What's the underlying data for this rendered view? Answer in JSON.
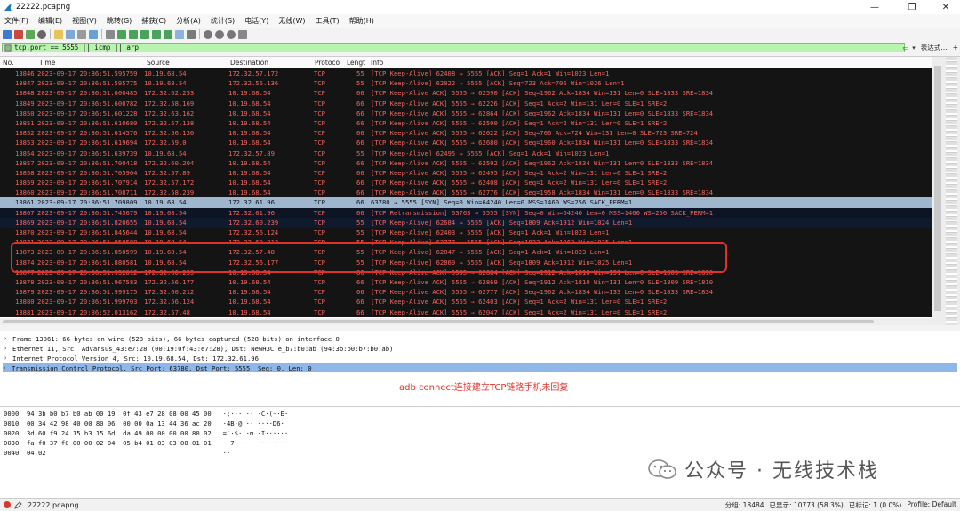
{
  "window": {
    "title": "22222.pcapng",
    "controls": [
      "—",
      "❐",
      "✕"
    ]
  },
  "menu": [
    "文件(F)",
    "编辑(E)",
    "视图(V)",
    "跳转(G)",
    "捕获(C)",
    "分析(A)",
    "统计(S)",
    "电话(Y)",
    "无线(W)",
    "工具(T)",
    "帮助(H)"
  ],
  "filter": {
    "text": "tcp.port == 5555 || icmp || arp",
    "expression_label": "表达式…",
    "plus": "+"
  },
  "columns": {
    "no": "No.",
    "time": "Time",
    "source": "Source",
    "destination": "Destination",
    "protocol": "Protoco",
    "length": "Lengt",
    "info": "Info"
  },
  "packets": [
    {
      "no": "13846",
      "time": "2023-09-17 20:36:51.595759",
      "src": "10.19.68.54",
      "dst": "172.32.57.172",
      "proto": "TCP",
      "len": "55",
      "info": "[TCP Keep-Alive] 62408 → 5555 [ACK] Seq=1 Ack=1 Win=1023 Len=1"
    },
    {
      "no": "13847",
      "time": "2023-09-17 20:36:51.595775",
      "src": "10.19.68.54",
      "dst": "172.32.56.136",
      "proto": "TCP",
      "len": "55",
      "info": "[TCP Keep-Alive] 62022 → 5555 [ACK] Seq=723 Ack=706 Win=1026 Len=1"
    },
    {
      "no": "13848",
      "time": "2023-09-17 20:36:51.600485",
      "src": "172.32.62.253",
      "dst": "10.19.68.54",
      "proto": "TCP",
      "len": "66",
      "info": "[TCP Keep-Alive ACK] 5555 → 62590 [ACK] Seq=1962 Ack=1834 Win=131 Len=0 SLE=1833 SRE=1834"
    },
    {
      "no": "13849",
      "time": "2023-09-17 20:36:51.600782",
      "src": "172.32.58.169",
      "dst": "10.19.68.54",
      "proto": "TCP",
      "len": "66",
      "info": "[TCP Keep-Alive ACK] 5555 → 62226 [ACK] Seq=1 Ack=2 Win=131 Len=0 SLE=1 SRE=2"
    },
    {
      "no": "13850",
      "time": "2023-09-17 20:36:51.601228",
      "src": "172.32.63.162",
      "dst": "10.19.68.54",
      "proto": "TCP",
      "len": "66",
      "info": "[TCP Keep-Alive ACK] 5555 → 62864 [ACK] Seq=1962 Ack=1834 Win=131 Len=0 SLE=1833 SRE=1834"
    },
    {
      "no": "13851",
      "time": "2023-09-17 20:36:51.610680",
      "src": "172.32.57.138",
      "dst": "10.19.68.54",
      "proto": "TCP",
      "len": "66",
      "info": "[TCP Keep-Alive ACK] 5555 → 62500 [ACK] Seq=1 Ack=2 Win=131 Len=0 SLE=1 SRE=2"
    },
    {
      "no": "13852",
      "time": "2023-09-17 20:36:51.614576",
      "src": "172.32.56.136",
      "dst": "10.19.68.54",
      "proto": "TCP",
      "len": "66",
      "info": "[TCP Keep-Alive ACK] 5555 → 62022 [ACK] Seq=706 Ack=724 Win=131 Len=0 SLE=723 SRE=724"
    },
    {
      "no": "13853",
      "time": "2023-09-17 20:36:51.619694",
      "src": "172.32.59.0",
      "dst": "10.19.68.54",
      "proto": "TCP",
      "len": "66",
      "info": "[TCP Keep-Alive ACK] 5555 → 62680 [ACK] Seq=1960 Ack=1834 Win=131 Len=0 SLE=1833 SRE=1834"
    },
    {
      "no": "13854",
      "time": "2023-09-17 20:36:51.639739",
      "src": "10.19.68.54",
      "dst": "172.32.57.89",
      "proto": "TCP",
      "len": "55",
      "info": "[TCP Keep-Alive] 62495 → 5555 [ACK] Seq=1 Ack=1 Win=1023 Len=1"
    },
    {
      "no": "13857",
      "time": "2023-09-17 20:36:51.700418",
      "src": "172.32.60.204",
      "dst": "10.19.68.54",
      "proto": "TCP",
      "len": "66",
      "info": "[TCP Keep-Alive ACK] 5555 → 62592 [ACK] Seq=1962 Ack=1834 Win=131 Len=0 SLE=1833 SRE=1834"
    },
    {
      "no": "13858",
      "time": "2023-09-17 20:36:51.705904",
      "src": "172.32.57.89",
      "dst": "10.19.68.54",
      "proto": "TCP",
      "len": "66",
      "info": "[TCP Keep-Alive ACK] 5555 → 62495 [ACK] Seq=1 Ack=2 Win=131 Len=0 SLE=1 SRE=2"
    },
    {
      "no": "13859",
      "time": "2023-09-17 20:36:51.707914",
      "src": "172.32.57.172",
      "dst": "10.19.68.54",
      "proto": "TCP",
      "len": "66",
      "info": "[TCP Keep-Alive ACK] 5555 → 62408 [ACK] Seq=1 Ack=2 Win=131 Len=0 SLE=1 SRE=2"
    },
    {
      "no": "13860",
      "time": "2023-09-17 20:36:51.708711",
      "src": "172.32.58.239",
      "dst": "10.19.68.54",
      "proto": "TCP",
      "len": "66",
      "info": "[TCP Keep-Alive ACK] 5555 → 62776 [ACK] Seq=1958 Ack=1834 Win=131 Len=0 SLE=1833 SRE=1834"
    },
    {
      "no": "13861",
      "time": "2023-09-17 20:36:51.709809",
      "src": "10.19.68.54",
      "dst": "172.32.61.96",
      "proto": "TCP",
      "len": "66",
      "info": "63780 → 5555 [SYN] Seq=0 Win=64240 Len=0 MSS=1460 WS=256 SACK_PERM=1"
    },
    {
      "no": "13867",
      "time": "2023-09-17 20:36:51.745679",
      "src": "10.19.68.54",
      "dst": "172.32.61.96",
      "proto": "TCP",
      "len": "66",
      "info": "[TCP Retransmission] 63763 → 5555 [SYN] Seq=0 Win=64240 Len=0 MSS=1460 WS=256 SACK_PERM=1"
    },
    {
      "no": "13869",
      "time": "2023-09-17 20:36:51.820655",
      "src": "10.19.68.54",
      "dst": "172.32.60.239",
      "proto": "TCP",
      "len": "55",
      "info": "[TCP Keep-Alive] 62684 → 5555 [ACK] Seq=1809 Ack=1912 Win=1024 Len=1"
    },
    {
      "no": "13870",
      "time": "2023-09-17 20:36:51.845644",
      "src": "10.19.68.54",
      "dst": "172.32.56.124",
      "proto": "TCP",
      "len": "55",
      "info": "[TCP Keep-Alive] 62403 → 5555 [ACK] Seq=1 Ack=1 Win=1023 Len=1"
    },
    {
      "no": "13871",
      "time": "2023-09-17 20:36:51.850588",
      "src": "10.19.68.54",
      "dst": "172.32.60.212",
      "proto": "TCP",
      "len": "55",
      "info": "[TCP Keep-Alive] 62777 → 5555 [ACK] Seq=1833 Ack=1962 Win=1025 Len=1"
    },
    {
      "no": "13873",
      "time": "2023-09-17 20:36:51.850599",
      "src": "10.19.68.54",
      "dst": "172.32.57.48",
      "proto": "TCP",
      "len": "55",
      "info": "[TCP Keep-Alive] 62047 → 5555 [ACK] Seq=1 Ack=1 Win=1023 Len=1"
    },
    {
      "no": "13874",
      "time": "2023-09-17 20:36:51.880581",
      "src": "10.19.68.54",
      "dst": "172.32.56.177",
      "proto": "TCP",
      "len": "55",
      "info": "[TCP Keep-Alive] 62869 → 5555 [ACK] Seq=1809 Ack=1912 Win=1025 Len=1"
    },
    {
      "no": "13877",
      "time": "2023-09-17 20:36:51.952012",
      "src": "172.32.60.239",
      "dst": "10.19.68.54",
      "proto": "TCP",
      "len": "66",
      "info": "[TCP Keep-Alive ACK] 5555 → 62684 [ACK] Seq=1912 Ack=1810 Win=131 Len=0 SLE=1809 SRE=1810"
    },
    {
      "no": "13878",
      "time": "2023-09-17 20:36:51.967583",
      "src": "172.32.56.177",
      "dst": "10.19.68.54",
      "proto": "TCP",
      "len": "66",
      "info": "[TCP Keep-Alive ACK] 5555 → 62869 [ACK] Seq=1912 Ack=1810 Win=131 Len=0 SLE=1809 SRE=1810"
    },
    {
      "no": "13879",
      "time": "2023-09-17 20:36:51.999175",
      "src": "172.32.60.212",
      "dst": "10.19.68.54",
      "proto": "TCP",
      "len": "66",
      "info": "[TCP Keep-Alive ACK] 5555 → 62777 [ACK] Seq=1962 Ack=1834 Win=133 Len=0 SLE=1833 SRE=1834"
    },
    {
      "no": "13880",
      "time": "2023-09-17 20:36:51.999703",
      "src": "172.32.56.124",
      "dst": "10.19.68.54",
      "proto": "TCP",
      "len": "66",
      "info": "[TCP Keep-Alive ACK] 5555 → 62403 [ACK] Seq=1 Ack=2 Win=131 Len=0 SLE=1 SRE=2"
    },
    {
      "no": "13881",
      "time": "2023-09-17 20:36:52.013162",
      "src": "172.32.57.48",
      "dst": "10.19.68.54",
      "proto": "TCP",
      "len": "66",
      "info": "[TCP Keep-Alive ACK] 5555 → 62047 [ACK] Seq=1 Ack=2 Win=131 Len=0 SLE=1 SRE=2"
    }
  ],
  "details": [
    "Frame 13861: 66 bytes on wire (528 bits), 66 bytes captured (528 bits) on interface 0",
    "Ethernet II, Src: Advansus_43:e7:28 (00:19:0f:43:e7:28), Dst: NewH3CTe_b7:b0:ab (94:3b:b0:b7:b0:ab)",
    "Internet Protocol Version 4, Src: 10.19.68.54, Dst: 172.32.61.96",
    "Transmission Control Protocol, Src Port: 63780, Dst Port: 5555, Seq: 0, Len: 0"
  ],
  "annotation": "adb connect连接建立TCP链路手机未回复",
  "bytes": [
    "0000  94 3b b0 b7 b0 ab 00 19  0f 43 e7 28 08 00 45 00   ·;······ ·C·(··E·",
    "0010  00 34 42 98 40 00 80 06  00 00 0a 13 44 36 ac 20   ·4B·@··· ····D6·",
    "0020  3d 60 f9 24 15 b3 15 6d  da 49 00 00 00 00 80 02   =`·$···m ·I······",
    "0030  fa f0 37 f0 00 00 02 04  05 b4 01 03 03 08 01 01   ··7····· ········",
    "0040  04 02                                              ··"
  ],
  "watermark": "公众号 · 无线技术栈",
  "status": {
    "file": "22222.pcapng",
    "packets": "分组: 18484",
    "displayed": "已显示: 10773 (58.3%)",
    "marked": "已标记: 1 (0.0%)",
    "profile": "Profile: Default"
  },
  "colors": {
    "row_bg": "#141414",
    "row_text": "#f2665e",
    "selected_row": "#9fb6cf",
    "filter_bg": "#b8f3b0",
    "highlight": "#e0302a",
    "detail_selected": "#8fb7ea"
  }
}
